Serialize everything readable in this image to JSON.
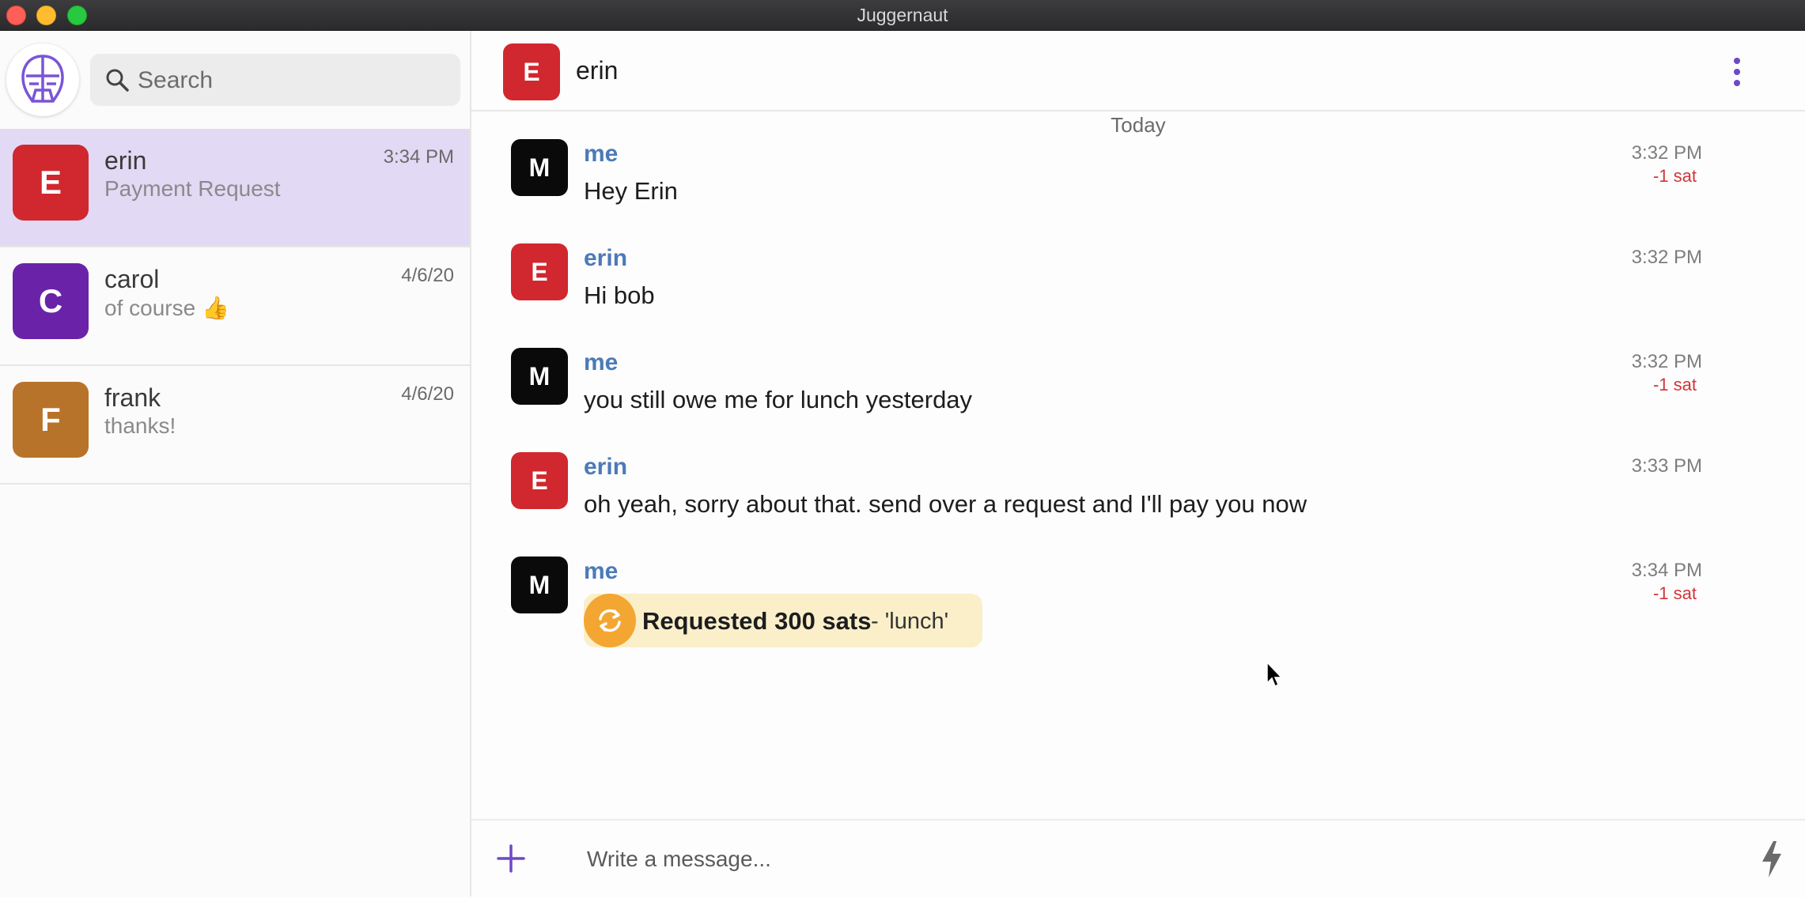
{
  "window": {
    "title": "Juggernaut"
  },
  "sidebar": {
    "search": {
      "placeholder": "Search",
      "value": ""
    },
    "conversations": [
      {
        "initial": "E",
        "name": "erin",
        "preview": "Payment Request",
        "time": "3:34 PM",
        "color": "#d0282e",
        "active": true
      },
      {
        "initial": "C",
        "name": "carol",
        "preview": "of course 👍",
        "time": "4/6/20",
        "color": "#6a23a8",
        "active": false
      },
      {
        "initial": "F",
        "name": "frank",
        "preview": "thanks!",
        "time": "4/6/20",
        "color": "#b8732a",
        "active": false
      }
    ]
  },
  "header": {
    "initial": "E",
    "name": "erin"
  },
  "chat": {
    "day_label": "Today",
    "messages": [
      {
        "initial": "M",
        "sender": "me",
        "text": "Hey Erin",
        "time": "3:32 PM",
        "cost": "-1 sat"
      },
      {
        "initial": "E",
        "sender": "erin",
        "text": "Hi bob",
        "time": "3:32 PM",
        "cost": ""
      },
      {
        "initial": "M",
        "sender": "me",
        "text": "you still owe me for lunch yesterday",
        "time": "3:32 PM",
        "cost": "-1 sat"
      },
      {
        "initial": "E",
        "sender": "erin",
        "text": "oh yeah, sorry about that. send over a request and I'll pay you now",
        "time": "3:33 PM",
        "cost": ""
      },
      {
        "initial": "M",
        "sender": "me",
        "time": "3:34 PM",
        "cost": "-1 sat",
        "payment_request": {
          "label": "Requested 300 sats",
          "memo": " - 'lunch'"
        }
      }
    ]
  },
  "composer": {
    "placeholder": "Write a message..."
  },
  "colors": {
    "accent": "#6e48c8",
    "me_avatar": "#0a0a0a",
    "erin_avatar": "#d0282e",
    "sender_name": "#4b7ab8",
    "cost": "#d2343b",
    "payment_bg": "#fbefc9",
    "payment_icon": "#f4a633"
  }
}
